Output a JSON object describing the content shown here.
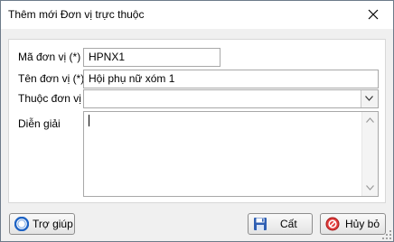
{
  "window": {
    "title": "Thêm mới Đơn vị trực thuộc"
  },
  "form": {
    "ma_don_vi": {
      "label": "Mã đơn vị (*)",
      "value": "HPNX1"
    },
    "ten_don_vi": {
      "label": "Tên đơn vị (*)",
      "value": "Hội phụ nữ xóm 1"
    },
    "thuoc_don_vi": {
      "label": "Thuộc đơn vị",
      "value": ""
    },
    "dien_giai": {
      "label": "Diễn giải",
      "value": ""
    }
  },
  "buttons": {
    "help_label": "Trợ giúp",
    "save_label": "Cất",
    "cancel_label": "Hủy bỏ"
  },
  "icons": {
    "close": "close-icon",
    "dropdown": "chevron-down-icon",
    "help": "help-icon",
    "save": "floppy-disk-icon",
    "cancel": "cancel-icon"
  }
}
